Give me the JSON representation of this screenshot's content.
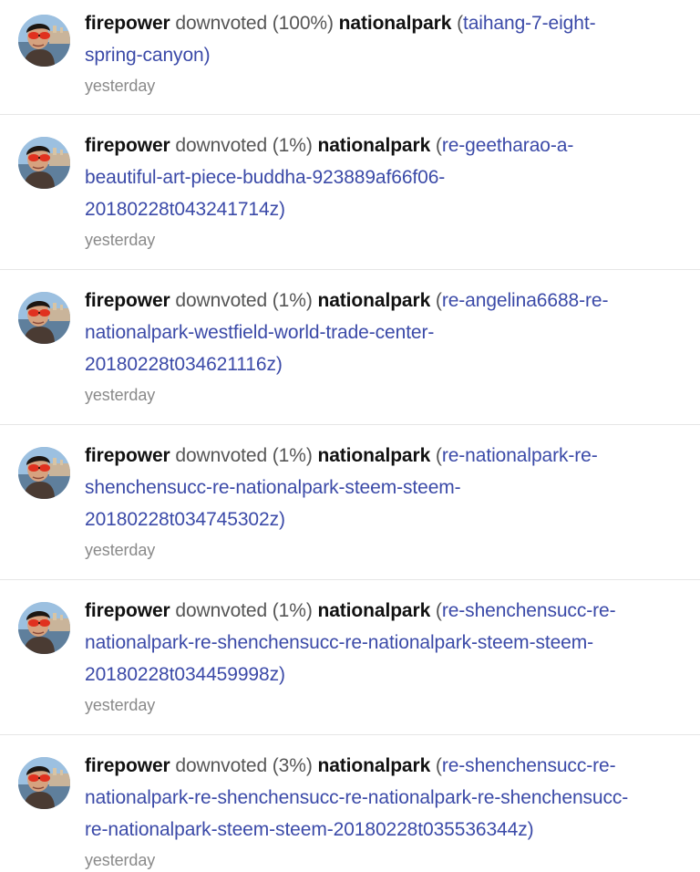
{
  "colors": {
    "link": "#3b4aa8",
    "bold_text": "#111111",
    "muted_text": "#555555",
    "timestamp": "#8a8a8a",
    "divider": "#e6e6e6"
  },
  "avatar_icon": "user-avatar-photo",
  "notifications": [
    {
      "actor": "firepower",
      "verb": "downvoted (100%)",
      "target": "nationalpark",
      "link_open": "(",
      "link_lines": [
        "taihang-7-eight-",
        "spring-canyon"
      ],
      "link_close": ")",
      "time": "yesterday"
    },
    {
      "actor": "firepower",
      "verb": "downvoted (1%)",
      "target": "nationalpark",
      "link_open": "(",
      "link_lines": [
        "re-geetharao-a-",
        "beautiful-art-piece-buddha-923889af66f06-",
        "20180228t043241714z"
      ],
      "link_close": ")",
      "time": "yesterday"
    },
    {
      "actor": "firepower",
      "verb": "downvoted (1%)",
      "target": "nationalpark",
      "link_open": "(",
      "link_lines": [
        "re-angelina6688-re-",
        "nationalpark-westfield-world-trade-center-",
        "20180228t034621116z"
      ],
      "link_close": ")",
      "time": "yesterday"
    },
    {
      "actor": "firepower",
      "verb": "downvoted (1%)",
      "target": "nationalpark",
      "link_open": "(",
      "link_lines": [
        "re-nationalpark-re-",
        "shenchensucc-re-nationalpark-steem-steem-",
        "20180228t034745302z"
      ],
      "link_close": ")",
      "time": "yesterday"
    },
    {
      "actor": "firepower",
      "verb": "downvoted (1%)",
      "target": "nationalpark",
      "link_open": "(",
      "link_lines": [
        "re-shenchensucc-re-",
        "nationalpark-re-shenchensucc-re-nationalpark-steem-steem-",
        "20180228t034459998z"
      ],
      "link_close": ")",
      "time": "yesterday"
    },
    {
      "actor": "firepower",
      "verb": "downvoted (3%)",
      "target": "nationalpark",
      "link_open": "(",
      "link_lines": [
        "re-shenchensucc-re-",
        "nationalpark-re-shenchensucc-re-nationalpark-re-shenchensucc-",
        "re-nationalpark-steem-steem-20180228t035536344z"
      ],
      "link_close": ")",
      "time": "yesterday"
    }
  ]
}
